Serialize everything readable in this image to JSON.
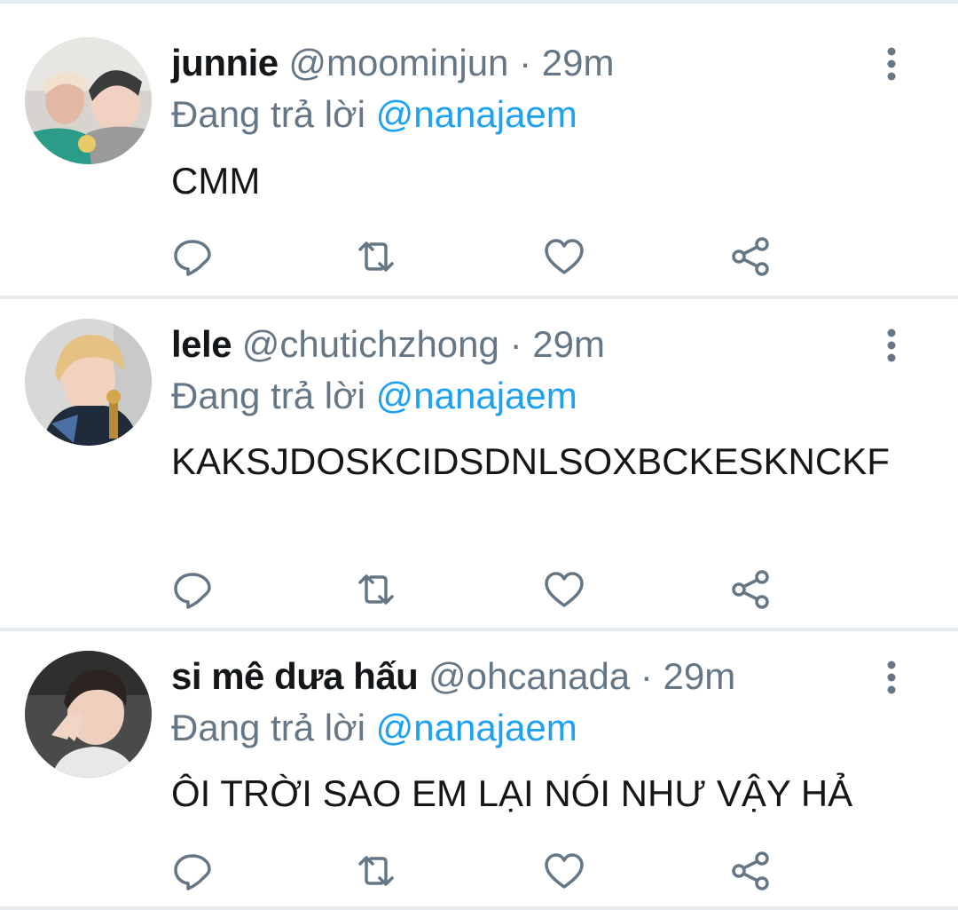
{
  "colors": {
    "text": "#14171a",
    "secondary": "#657786",
    "link": "#1da1f2",
    "divider": "#e6ecf0"
  },
  "reply_prefix": "Đang trả lời",
  "tweets": [
    {
      "name": "junnie",
      "handle": "@moominjun",
      "separator": "·",
      "time": "29m",
      "mention": "@nanajaem",
      "text": "CMM"
    },
    {
      "name": "lele",
      "handle": "@chutichzhong",
      "separator": "·",
      "time": "29m",
      "mention": "@nanajaem",
      "text": "KAKSJDOSKCIDSDNLSOXBCKESKNCKF"
    },
    {
      "name": "si mê dưa hấu",
      "handle": "@ohcanada",
      "separator": "·",
      "time": "29m",
      "mention": "@nanajaem",
      "text": "ÔI TRỜI SAO EM LẠI NÓI NHƯ VẬY HẢ"
    }
  ],
  "icons": [
    "reply-icon",
    "retweet-icon",
    "like-icon",
    "share-icon",
    "more-options-icon"
  ]
}
